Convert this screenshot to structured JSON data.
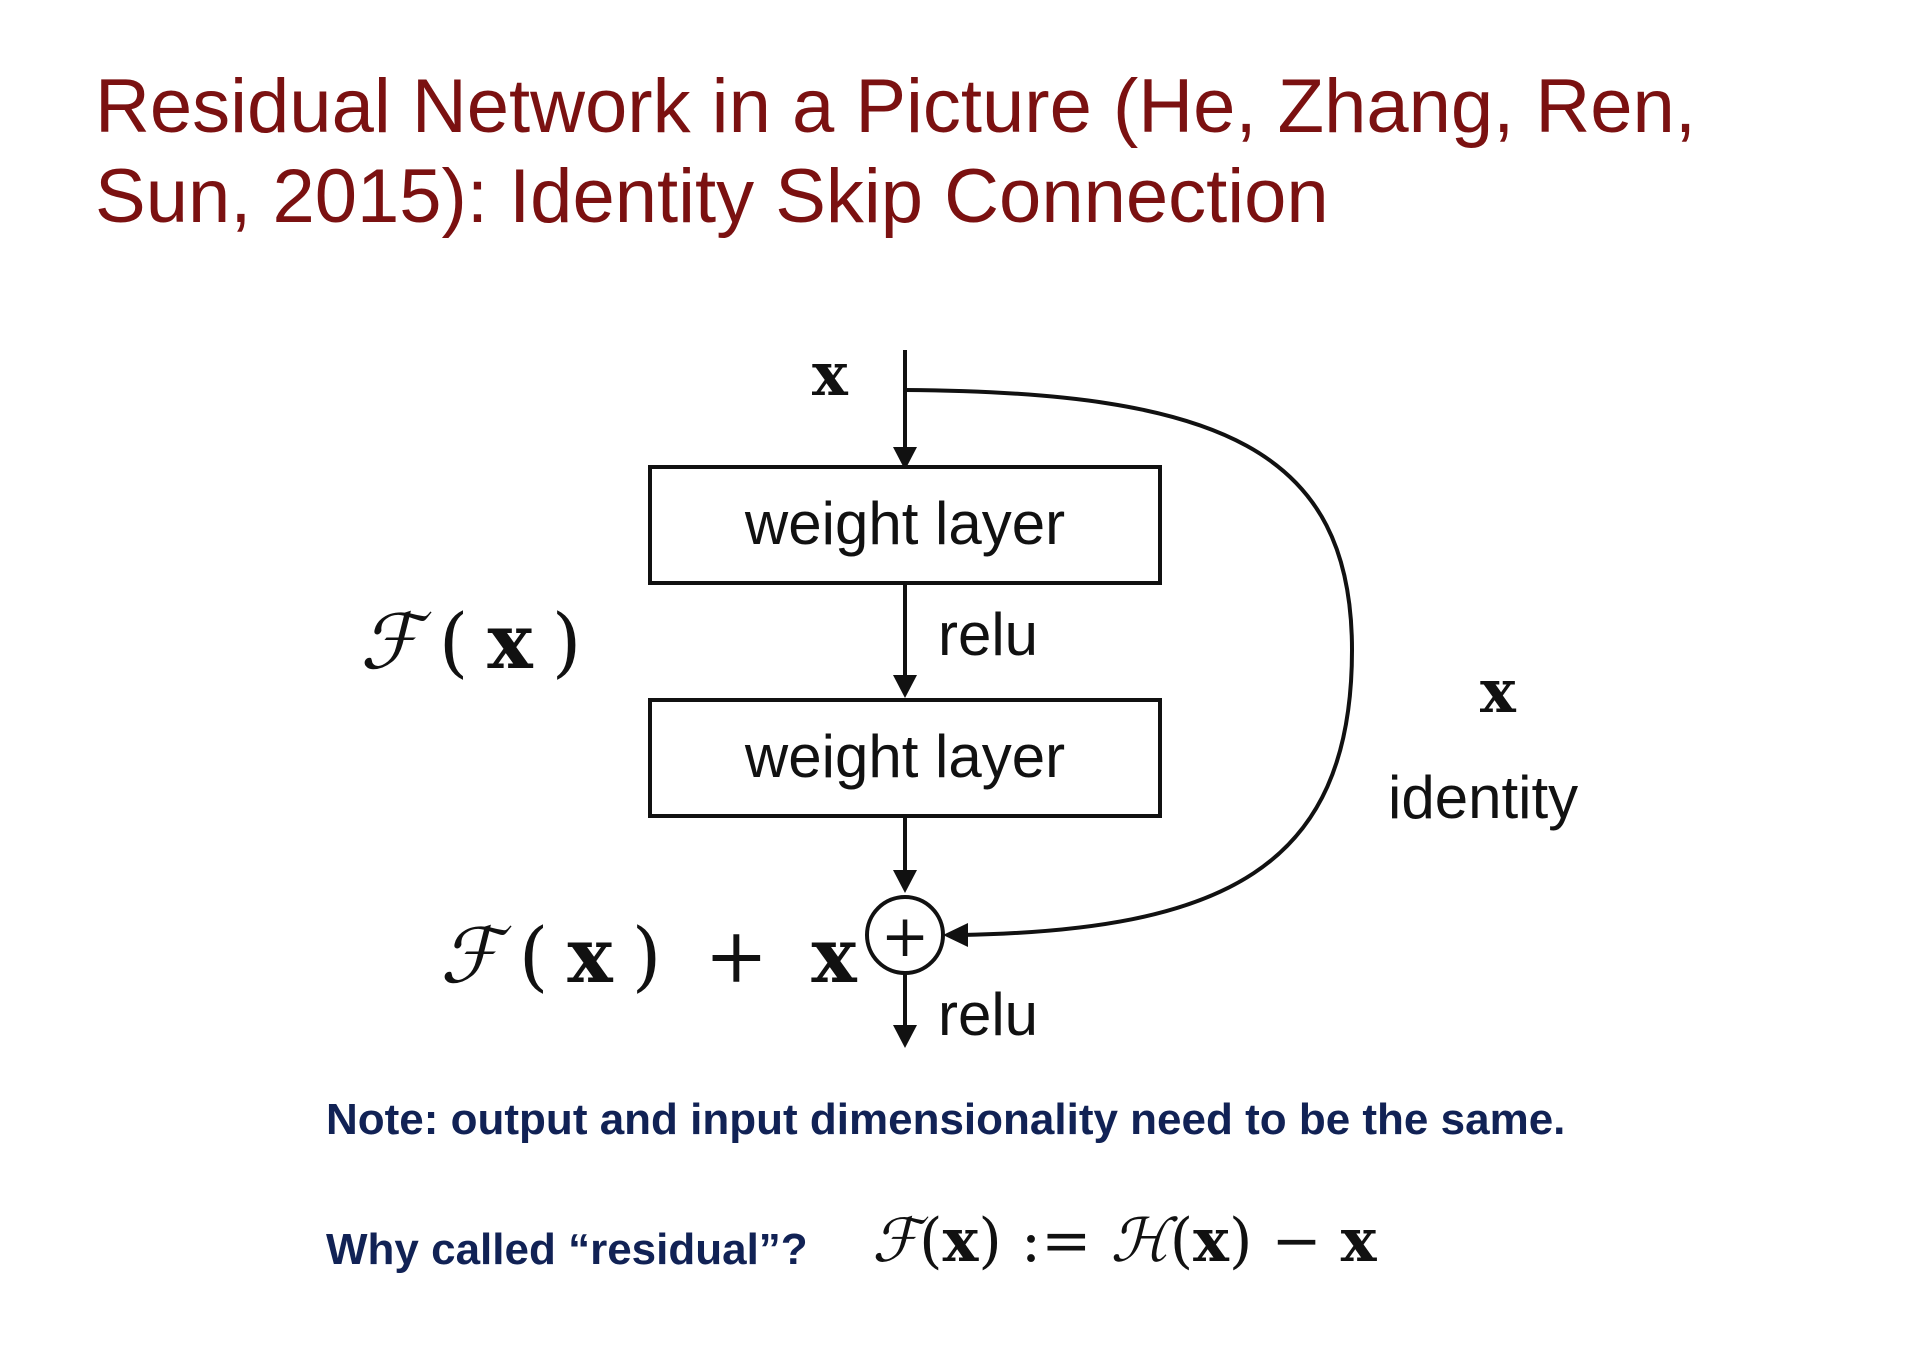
{
  "title": "Residual Network in a Picture (He, Zhang, Ren, Sun, 2015): Identity Skip Connection",
  "diagram": {
    "input_label": "x",
    "layer1_label": "weight layer",
    "activation1_label": "relu",
    "layer2_label": "weight layer",
    "sum_symbol": "+",
    "output_activation_label": "relu",
    "residual_function_label": {
      "script_f": "ℱ",
      "open_paren": "(",
      "x": "x",
      "close_paren": ")"
    },
    "sum_output_label": {
      "script_f": "ℱ",
      "open_paren": "(",
      "x": "x",
      "close_paren": ")",
      "plus": " + ",
      "x2": "x"
    },
    "shortcut_x_label": "x",
    "shortcut_label": "identity"
  },
  "note": "Note: output and input dimensionality need to be the same.",
  "question": "Why called “residual”?",
  "equation": {
    "script_f": "ℱ",
    "x1": "x",
    "assign": " := ",
    "script_h": "ℋ",
    "x2": "x",
    "minus": " − ",
    "x3": "x"
  }
}
